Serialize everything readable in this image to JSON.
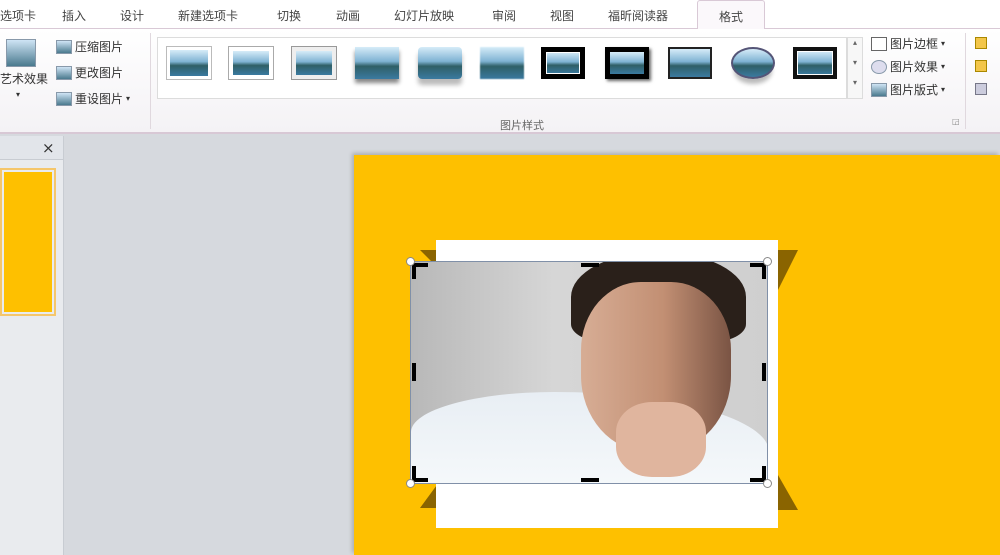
{
  "tabs": [
    {
      "label": "选项卡"
    },
    {
      "label": "插入"
    },
    {
      "label": "设计"
    },
    {
      "label": "新建选项卡"
    },
    {
      "label": "切换"
    },
    {
      "label": "动画"
    },
    {
      "label": "幻灯片放映"
    },
    {
      "label": "审阅"
    },
    {
      "label": "视图"
    },
    {
      "label": "福昕阅读器"
    },
    {
      "label": "格式"
    }
  ],
  "ribbon": {
    "adjust": {
      "art_effects": "艺术效果",
      "compress": "压缩图片",
      "change": "更改图片",
      "reset": "重设图片"
    },
    "styles_group_label": "图片样式",
    "picture_border": "图片边框",
    "picture_effects": "图片效果",
    "picture_layout": "图片版式"
  },
  "pane": {
    "close": "×"
  },
  "colors": {
    "slide_bg": "#fec000",
    "ribbon_accent": "#d8c8d5"
  }
}
